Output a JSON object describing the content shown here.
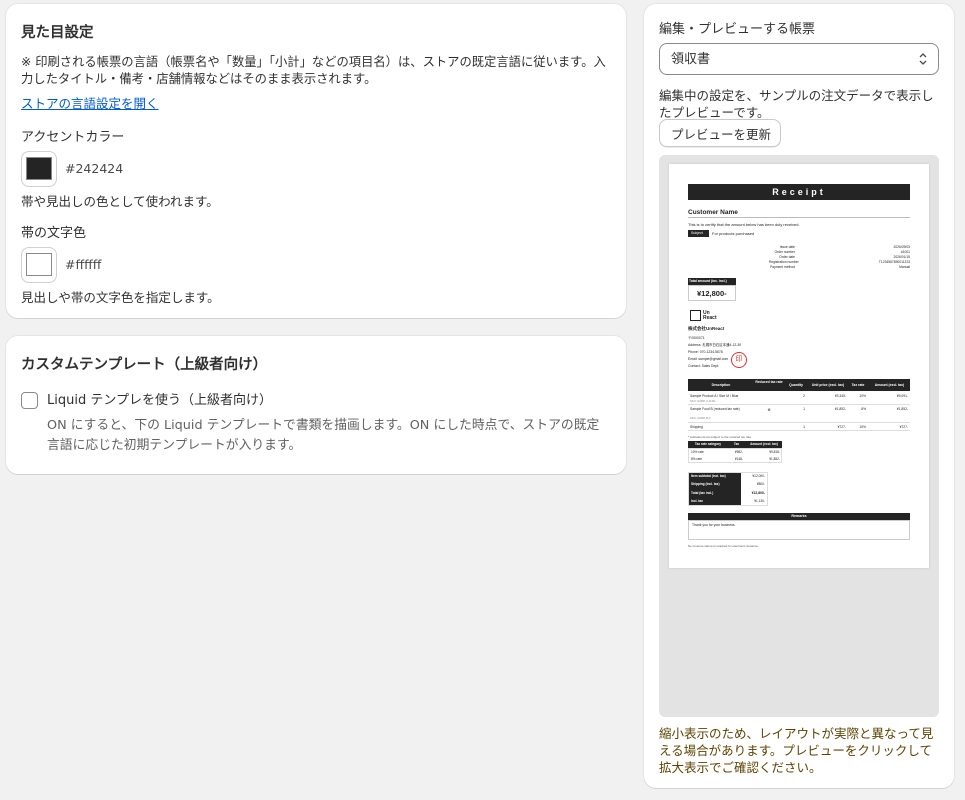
{
  "appearance": {
    "title": "見た目設定",
    "note": "※ 印刷される帳票の言語（帳票名や「数量」「小計」などの項目名）は、ストアの既定言語に従います。入力したタイトル・備考・店舗情報などはそのまま表示されます。",
    "lang_link": "ストアの言語設定を開く",
    "accent_label": "アクセントカラー",
    "accent_value": "#242424",
    "accent_help": "帯や見出しの色として使われます。",
    "band_label": "帯の文字色",
    "band_value": "#ffffff",
    "band_help": "見出しや帯の文字色を指定します。"
  },
  "custom": {
    "title": "カスタムテンプレート（上級者向け）",
    "checkbox_label": "Liquid テンプレを使う（上級者向け）",
    "checkbox_checked": false,
    "help": "ON にすると、下の Liquid テンプレートで書類を描画します。ON にした時点で、ストアの既定言語に応じた初期テンプレートが入ります。"
  },
  "preview": {
    "select_label": "編集・プレビューする帳票",
    "select_value": "領収書",
    "desc": "編集中の設定を、サンプルの注文データで表示したプレビューです。",
    "refresh_button": "プレビューを更新",
    "warning": "縮小表示のため、レイアウトが実際と異なって見える場合があります。プレビューをクリックして拡大表示でご確認ください。",
    "warning_color": "#5e4200"
  },
  "receipt": {
    "title": "Receipt",
    "customer": "Customer Name",
    "certify": "This is to certify that the amount below has been duly received.",
    "subject_tag": "Subject",
    "subject_text": "For products purchased",
    "meta_labels": [
      "Issue date",
      "Order number",
      "Order date",
      "Registration number",
      "Payment method"
    ],
    "meta_values": [
      "2026/09/03",
      "#1001",
      "2026/01/15",
      "T1234567890011223",
      "Manual"
    ],
    "total_label": "Total amount (inc. incl.)",
    "total_value": "¥12,800-",
    "logo_line1": "Un",
    "logo_line2": "React",
    "company": "株式会社UnReact",
    "address_lines": [
      "〒0000071",
      "Address: 札幌市白石区本通4-12-30",
      "Phone: 070-1234-5678",
      "Email: sample@gmail.com",
      "Contact: Sales Dept."
    ],
    "stamp": "印",
    "table_headers": [
      "Description",
      "Reduced tax rate",
      "Quantity",
      "Unit price (excl. tax)",
      "Tax rate",
      "Amount (excl. tax)"
    ],
    "rows": [
      {
        "desc": "Sample Product A / Size M / Blue",
        "sku": "SKU: SAMP-A-M-BL",
        "reduced": "",
        "qty": "2",
        "unit": "¥3,345-",
        "rate": "10%",
        "amount": "¥9,091-"
      },
      {
        "desc": "Sample Food B (reduced tax rate)",
        "sku": "SKU: SAMP-B-F",
        "reduced": "※",
        "qty": "1",
        "unit": "¥1,852-",
        "rate": "8%",
        "amount": "¥1,852-"
      },
      {
        "desc": "Shipping",
        "sku": "",
        "reduced": "",
        "qty": "1",
        "unit": "¥727-",
        "rate": "10%",
        "amount": "¥727-"
      }
    ],
    "reduced_note": "* indicates items subject to the reduced tax rate.",
    "tax_headers": [
      "Tax rate category",
      "Tax",
      "Amount (excl. tax)"
    ],
    "tax_rows": [
      [
        "10% rate",
        "¥982-",
        "¥9,818-"
      ],
      [
        "8% rate",
        "¥148-",
        "¥1,852-"
      ]
    ],
    "sum_rows": [
      [
        "Item subtotal (incl. tax)",
        "¥12,000-"
      ],
      [
        "Shipping (incl. tax)",
        "¥800-"
      ],
      [
        "Total (tax incl.)",
        "¥12,800-"
      ],
      [
        "Incl. tax",
        "¥1,130-"
      ]
    ],
    "remarks_title": "Remarks",
    "remarks_text": "Thank you for your business.",
    "footer": "No revenue stamp is required for electronic issuance."
  }
}
